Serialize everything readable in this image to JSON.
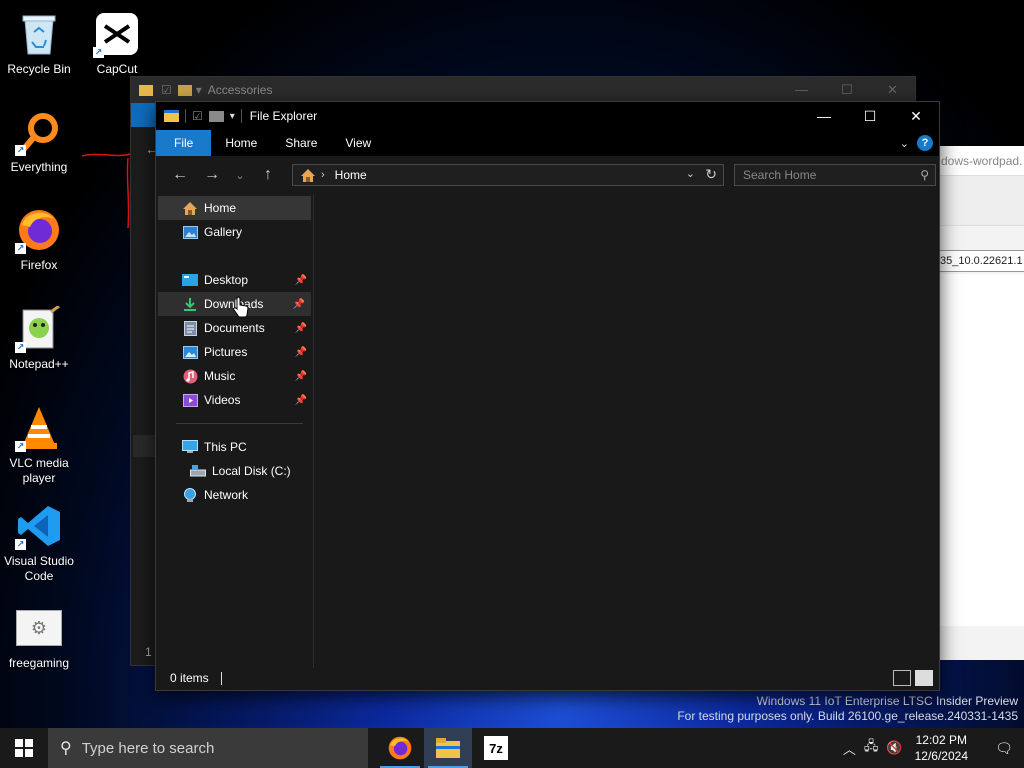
{
  "desktop": {
    "icons": [
      {
        "label": "Recycle Bin",
        "icon": "recycle-bin-icon"
      },
      {
        "label": "CapCut",
        "icon": "capcut-icon"
      },
      {
        "label": "Everything",
        "icon": "everything-search-icon"
      },
      {
        "label": "Firefox",
        "icon": "firefox-icon"
      },
      {
        "label": "Notepad++",
        "icon": "notepad-plus-plus-icon"
      },
      {
        "label": "VLC media player",
        "icon": "vlc-icon"
      },
      {
        "label": "Visual Studio Code",
        "icon": "vscode-icon"
      },
      {
        "label": "freegaming",
        "icon": "freegaming-icon"
      }
    ],
    "watermark_line1": "Windows 11 IoT Enterprise LTSC Insider Preview",
    "watermark_line2": "For testing purposes only. Build 26100.ge_release.240331-1435"
  },
  "background_windows": {
    "accessories_title": "Accessories",
    "accessories_status": "1 i",
    "wordpad_address": "dows-wordpad.",
    "wordpad_path": "35_10.0.22621.1"
  },
  "explorer": {
    "title": "File Explorer",
    "ribbon_tabs": [
      "File",
      "Home",
      "Share",
      "View"
    ],
    "help_label": "?",
    "address_crumb": "Home",
    "search_placeholder": "Search Home",
    "nav": {
      "home": "Home",
      "gallery": "Gallery",
      "desktop": "Desktop",
      "downloads": "Downloads",
      "documents": "Documents",
      "pictures": "Pictures",
      "music": "Music",
      "videos": "Videos",
      "this_pc": "This PC",
      "local_disk": "Local Disk (C:)",
      "network": "Network"
    },
    "status_items": "0 items"
  },
  "taskbar": {
    "search_placeholder": "Type here to search",
    "time": "12:02 PM",
    "date": "12/6/2024",
    "sevenzip_label": "7z"
  }
}
